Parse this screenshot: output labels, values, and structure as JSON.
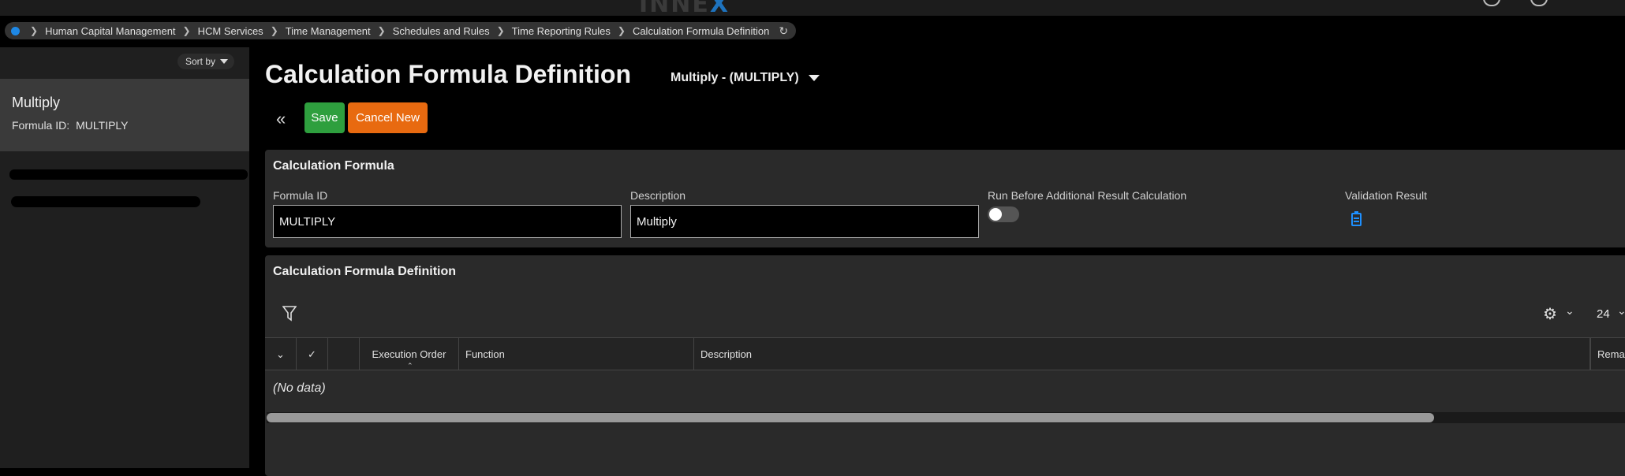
{
  "app": {
    "logo_text": "INNE",
    "logo_accent": "X",
    "accent_color": "#1e73be"
  },
  "breadcrumb": {
    "items": [
      "Human Capital Management",
      "HCM Services",
      "Time Management",
      "Schedules and Rules",
      "Time Reporting Rules",
      "Calculation Formula Definition"
    ],
    "separator": ">"
  },
  "sidebar": {
    "sort_label": "Sort by",
    "selected": {
      "name": "Multiply",
      "formula_id_label": "Formula ID:",
      "formula_id_value": "MULTIPLY"
    }
  },
  "page": {
    "title": "Calculation Formula Definition",
    "record_selector": "Multiply - (MULTIPLY)"
  },
  "toolbar": {
    "save_label": "Save",
    "cancel_label": "Cancel New"
  },
  "calc_formula": {
    "title": "Calculation Formula",
    "formula_id_label": "Formula ID",
    "formula_id_value": "MULTIPLY",
    "description_label": "Description",
    "description_value": "Multiply",
    "run_before_label": "Run Before Additional Result Calculation",
    "run_before_on": false,
    "validation_label": "Validation Result"
  },
  "definition": {
    "title": "Calculation Formula Definition",
    "page_size": "24",
    "columns": [
      "Execution Order",
      "Function",
      "Description",
      "Remar"
    ],
    "empty_text": "(No data)"
  }
}
